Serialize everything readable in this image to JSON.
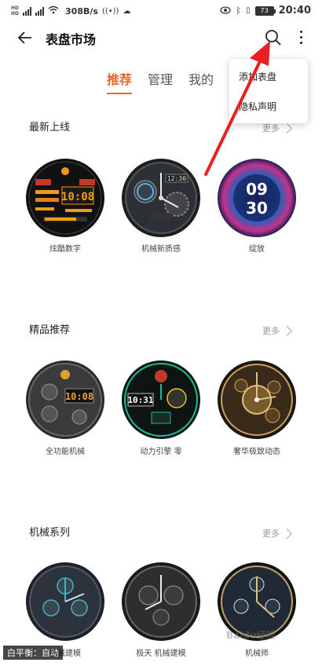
{
  "status_bar": {
    "speed": "308B/s",
    "battery": "73",
    "time": "20:40"
  },
  "header": {
    "title": "表盘市场"
  },
  "tabs": [
    {
      "label": "推荐",
      "active": true
    },
    {
      "label": "管理",
      "active": false
    },
    {
      "label": "我的",
      "active": false
    }
  ],
  "popup_menu": {
    "items": [
      "添加表盘",
      "隐私声明"
    ]
  },
  "sections": [
    {
      "title": "最新上线",
      "more": "更多",
      "faces": [
        {
          "name": "炫酷数字",
          "time": "10:08"
        },
        {
          "name": "机械新质感",
          "time": "12:30"
        },
        {
          "name": "绽放",
          "time": "09 30"
        }
      ]
    },
    {
      "title": "精品推荐",
      "more": "更多",
      "faces": [
        {
          "name": "全功能机械",
          "time": "10:08"
        },
        {
          "name": "动力引擎 零",
          "time": "10:31"
        },
        {
          "name": "奢华极致动态",
          "time": ""
        }
      ]
    },
    {
      "title": "机械系列",
      "more": "更多",
      "faces": [
        {
          "name": "机械建模"
        },
        {
          "name": "极天 机械建模"
        },
        {
          "name": "机械师"
        }
      ]
    }
  ],
  "watermark": {
    "left": "白平衡：自动",
    "right": "Baidu经验"
  }
}
